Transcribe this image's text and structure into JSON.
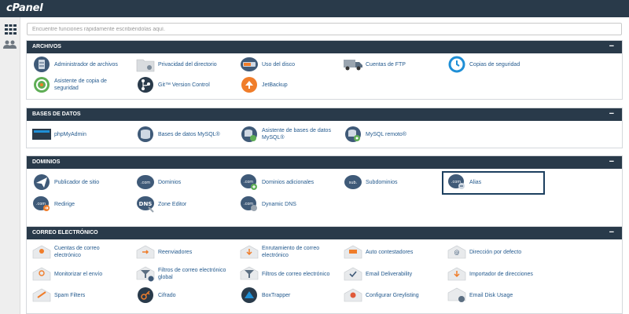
{
  "app": {
    "logo": "cPanel"
  },
  "search": {
    "placeholder": "Encuentre funciones rápidamente escribiéndolas aquí."
  },
  "sections": {
    "archivos": {
      "title": "ARCHIVOS",
      "collapse": "−",
      "items": [
        {
          "label": "Administrador de archivos",
          "icon": "file-cabinet-icon"
        },
        {
          "label": "Privacidad del directorio",
          "icon": "folder-icon"
        },
        {
          "label": "Uso del disco",
          "icon": "disk-icon"
        },
        {
          "label": "Cuentas de FTP",
          "icon": "truck-icon"
        },
        {
          "label": "Copias de seguridad",
          "icon": "clock-backup-icon"
        },
        {
          "label": "Asistente de copia de seguridad",
          "icon": "backup-wizard-icon"
        },
        {
          "label": "Git™ Version Control",
          "icon": "git-icon"
        },
        {
          "label": "JetBackup",
          "icon": "jetbackup-icon"
        }
      ]
    },
    "bases": {
      "title": "BASES DE DATOS",
      "collapse": "−",
      "items": [
        {
          "label": "phpMyAdmin",
          "icon": "phpmyadmin-icon"
        },
        {
          "label": "Bases de datos MySQL®",
          "icon": "database-icon"
        },
        {
          "label": "Asistente de bases de datos MySQL®",
          "icon": "database-wizard-icon"
        },
        {
          "label": "MySQL remoto®",
          "icon": "remote-database-icon"
        }
      ]
    },
    "dominios": {
      "title": "DOMINIOS",
      "collapse": "−",
      "items": [
        {
          "label": "Publicador de sitio",
          "icon": "paper-plane-icon"
        },
        {
          "label": "Dominios",
          "icon": "dotcom-icon"
        },
        {
          "label": "Dominios adicionales",
          "icon": "dotcom-add-icon"
        },
        {
          "label": "Subdominios",
          "icon": "subdomain-icon"
        },
        {
          "label": "Alias",
          "icon": "dotcom-alias-icon"
        },
        {
          "label": "Redirige",
          "icon": "dotcom-redirect-icon"
        },
        {
          "label": "Zone Editor",
          "icon": "dns-icon"
        },
        {
          "label": "Dynamic DNS",
          "icon": "dotcom-dynamic-icon"
        }
      ]
    },
    "correo": {
      "title": "CORREO ELECTRÓNICO",
      "collapse": "−",
      "items": [
        {
          "label": "Cuentas de correo electrónico",
          "icon": "email-accounts-icon"
        },
        {
          "label": "Reenviadores",
          "icon": "forwarders-icon"
        },
        {
          "label": "Enrutamiento de correo electrónico",
          "icon": "email-routing-icon"
        },
        {
          "label": "Auto contestadores",
          "icon": "autoresponder-icon"
        },
        {
          "label": "Dirección por defecto",
          "icon": "default-address-icon"
        },
        {
          "label": "Monitorizar el envío",
          "icon": "track-delivery-icon"
        },
        {
          "label": "Filtros de correo electrónico global",
          "icon": "global-filter-icon"
        },
        {
          "label": "Filtros de correo electrónico",
          "icon": "email-filter-icon"
        },
        {
          "label": "Email Deliverability",
          "icon": "deliverability-icon"
        },
        {
          "label": "Importador de direcciones",
          "icon": "address-importer-icon"
        },
        {
          "label": "Spam Filters",
          "icon": "spam-filter-icon"
        },
        {
          "label": "Cifrado",
          "icon": "encryption-icon"
        },
        {
          "label": "BoxTrapper",
          "icon": "boxtrapper-icon"
        },
        {
          "label": "Configurar Greylisting",
          "icon": "greylisting-icon"
        },
        {
          "label": "Email Disk Usage",
          "icon": "email-disk-usage-icon"
        }
      ]
    }
  },
  "colors": {
    "header": "#293a4a",
    "link": "#245a8e",
    "accent_orange": "#f07d2a",
    "accent_blue": "#1f8fd6"
  }
}
